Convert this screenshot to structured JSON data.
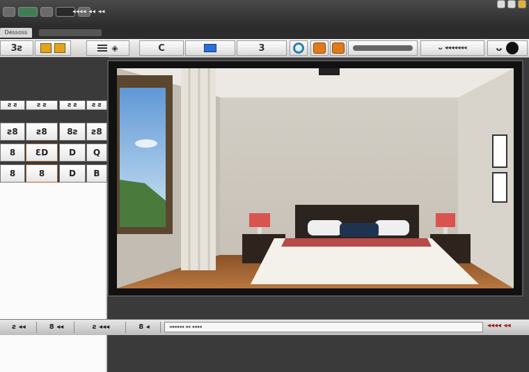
{
  "window": {
    "title_text": "◂◂◂◂ ◂◂ ◂◂",
    "subtab_label": "Dessoss"
  },
  "toolbar": {
    "tool_text_1": "3ƨ",
    "tool_text_rotate": "C",
    "tool_text_3": "3",
    "tool_text_4": "ᴗ ◂◂◂◂◂◂◂",
    "tool_text_5": "ᴗ"
  },
  "keypad": {
    "rows": [
      [
        "ƨ ƨ",
        "ƨ ƨ",
        "ƨ ƨ",
        "ƨ ƨ"
      ],
      [
        "ƨ8",
        "ƨ8",
        "8ƨ",
        "ƨ8"
      ],
      [
        "8",
        "ƐD",
        "D",
        "Q"
      ],
      [
        "8",
        "8",
        "D",
        "B"
      ]
    ]
  },
  "status": {
    "item_1": "ƨ ◂◂",
    "item_2": "8 ◂◂",
    "item_3": "ƨ ◂◂◂",
    "item_4": "8 ◂",
    "field_text": "◂◂◂◂◂◂ ◂◂ ◂◂◂◂",
    "right_text": "◂◂◂◂ ◂◂"
  },
  "colors": {
    "accent_orange": "#e07b1c",
    "accent_blue": "#2d6fd6",
    "lamp_red": "#d9534f",
    "wall": "#d8d3ca",
    "floor": "#a8683a"
  }
}
